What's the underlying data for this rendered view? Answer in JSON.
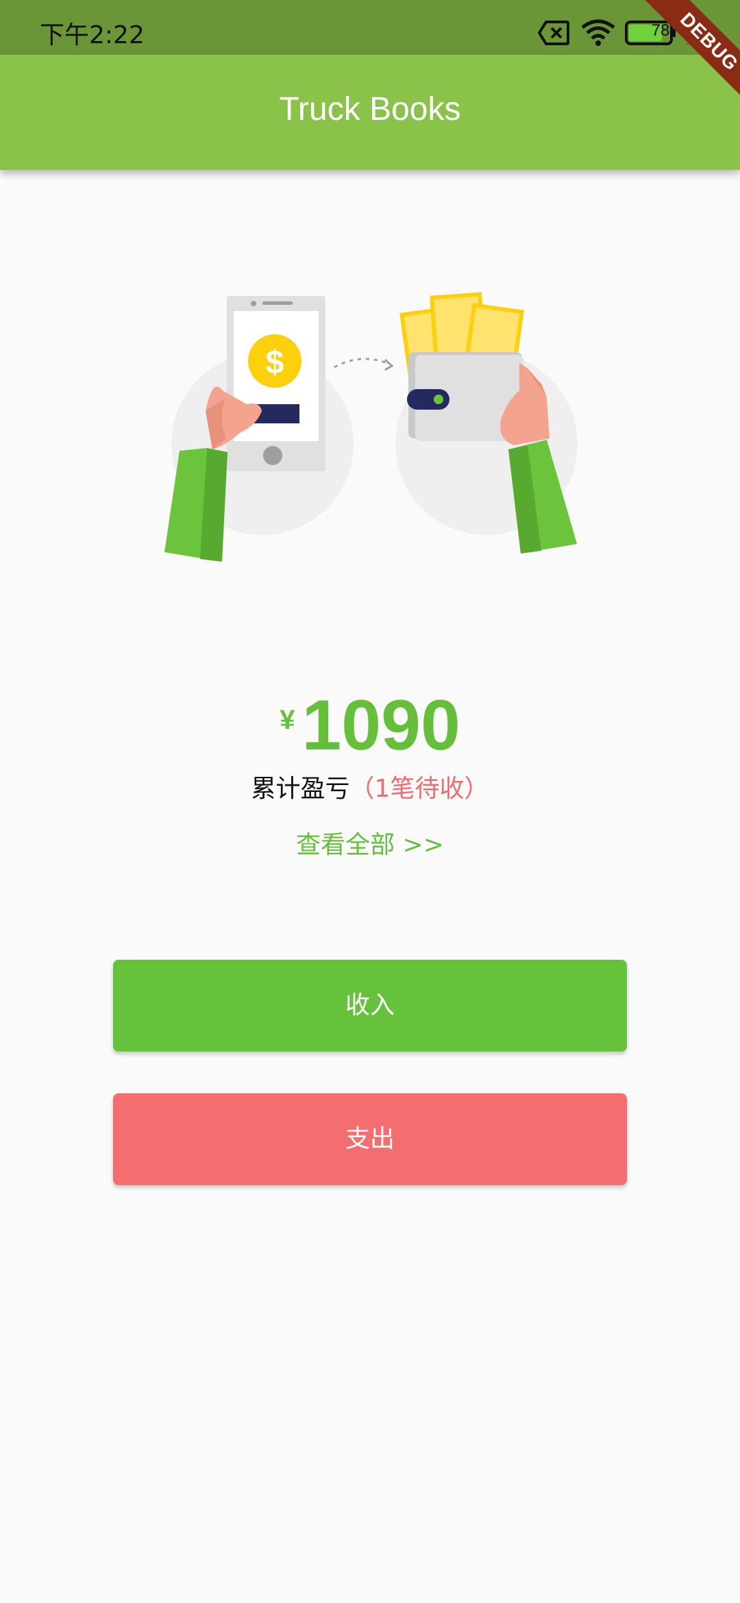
{
  "status_bar": {
    "time": "下午2:22",
    "battery_level": "78",
    "icons": [
      "sim-error-icon",
      "wifi-icon",
      "battery-icon",
      "charging-icon"
    ]
  },
  "debug_banner": {
    "label": "DEBUG"
  },
  "app_bar": {
    "title": "Truck Books"
  },
  "summary": {
    "currency_symbol": "¥",
    "amount": "1090",
    "label": "累计盈亏",
    "pending_note": "（1笔待收）",
    "view_all": "查看全部 >>"
  },
  "actions": {
    "income_label": "收入",
    "expense_label": "支出"
  },
  "colors": {
    "status_bar": "#6b9638",
    "app_bar": "#8bc34a",
    "accent_green": "#65bf3a",
    "accent_red": "#f46e70",
    "ribbon": "#8a2b14",
    "background": "#fafafa"
  }
}
